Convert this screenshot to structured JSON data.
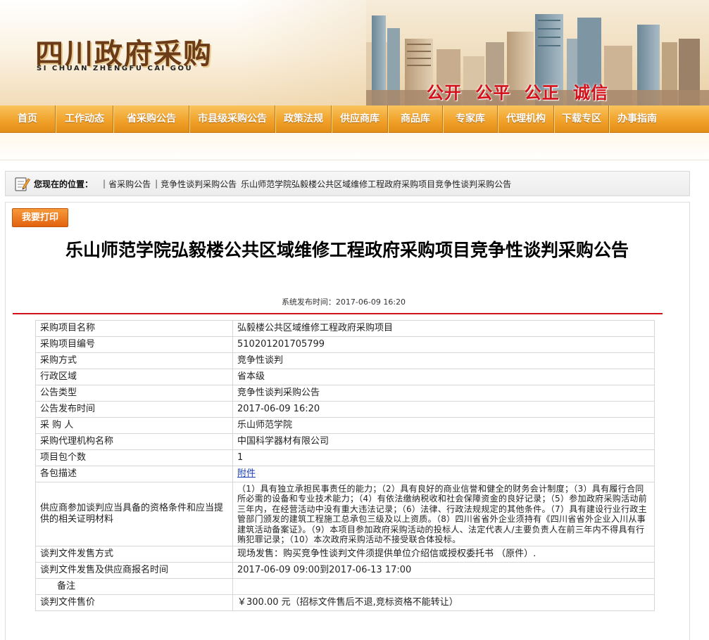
{
  "header": {
    "logo": "四川政府采购",
    "pinyin": "SI CHUAN ZHENGFU CAI GOU",
    "slogan": [
      "公开",
      "公平",
      "公正",
      "诚信"
    ]
  },
  "nav": [
    "首页",
    "工作动态",
    "省采购公告",
    "市县级采购公告",
    "政策法规",
    "供应商库",
    "商品库",
    "专家库",
    "代理机构",
    "下载专区",
    "办事指南"
  ],
  "breadcrumb": {
    "label": "您现在的位置：",
    "items": [
      "省采购公告",
      "竞争性谈判采购公告",
      "乐山师范学院弘毅楼公共区域维修工程政府采购项目竞争性谈判采购公告"
    ]
  },
  "article": {
    "print_label": "我要打印",
    "title": "乐山师范学院弘毅楼公共区域维修工程政府采购项目竞争性谈判采购公告",
    "publish_time": "系统发布时间：2017-06-09 16:20",
    "rows": [
      {
        "key": "采购项目名称",
        "value": "弘毅楼公共区域维修工程政府采购项目"
      },
      {
        "key": "采购项目编号",
        "value": "510201201705799"
      },
      {
        "key": "采购方式",
        "value": "竞争性谈判"
      },
      {
        "key": "行政区域",
        "value": "省本级"
      },
      {
        "key": "公告类型",
        "value": "竞争性谈判采购公告"
      },
      {
        "key": "公告发布时间",
        "value": "2017-06-09 16:20"
      },
      {
        "key": "采 购 人",
        "value": "乐山师范学院"
      },
      {
        "key": "采购代理机构名称",
        "value": "中国科学器材有限公司"
      },
      {
        "key": "项目包个数",
        "value": "1"
      },
      {
        "key": "各包描述",
        "value": "附件"
      },
      {
        "key": "供应商参加谈判应当具备的资格条件和应当提供的相关证明材料",
        "value": "（1）具有独立承担民事责任的能力；（2）具有良好的商业信誉和健全的财务会计制度；（3）具有履行合同所必需的设备和专业技术能力；（4）有依法缴纳税收和社会保障资金的良好记录；（5）参加政府采购活动前三年内，在经营活动中没有重大违法记录；（6）法律、行政法规规定的其他条件。（7）具有建设行业行政主管部门颁发的建筑工程施工总承包三级及以上资质。（8）四川省省外企业须持有《四川省省外企业入川从事建筑活动备案证》。（9）本项目参加政府采购活动的投标人、法定代表人/主要负责人在前三年内不得具有行贿犯罪记录；（10）本次政府采购活动不接受联合体投标。"
      },
      {
        "key": "谈判文件发售方式",
        "value": "现场发售：购买竞争性谈判文件须提供单位介绍信或授权委托书 （原件）."
      },
      {
        "key": "谈判文件发售及供应商报名时间",
        "value": "2017-06-09 09:00到2017-06-13 17:00"
      },
      {
        "key": "备注",
        "value": ""
      },
      {
        "key": "谈判文件售价",
        "value": "￥300.00 元（招标文件售后不退,竞标资格不能转让）"
      }
    ]
  }
}
